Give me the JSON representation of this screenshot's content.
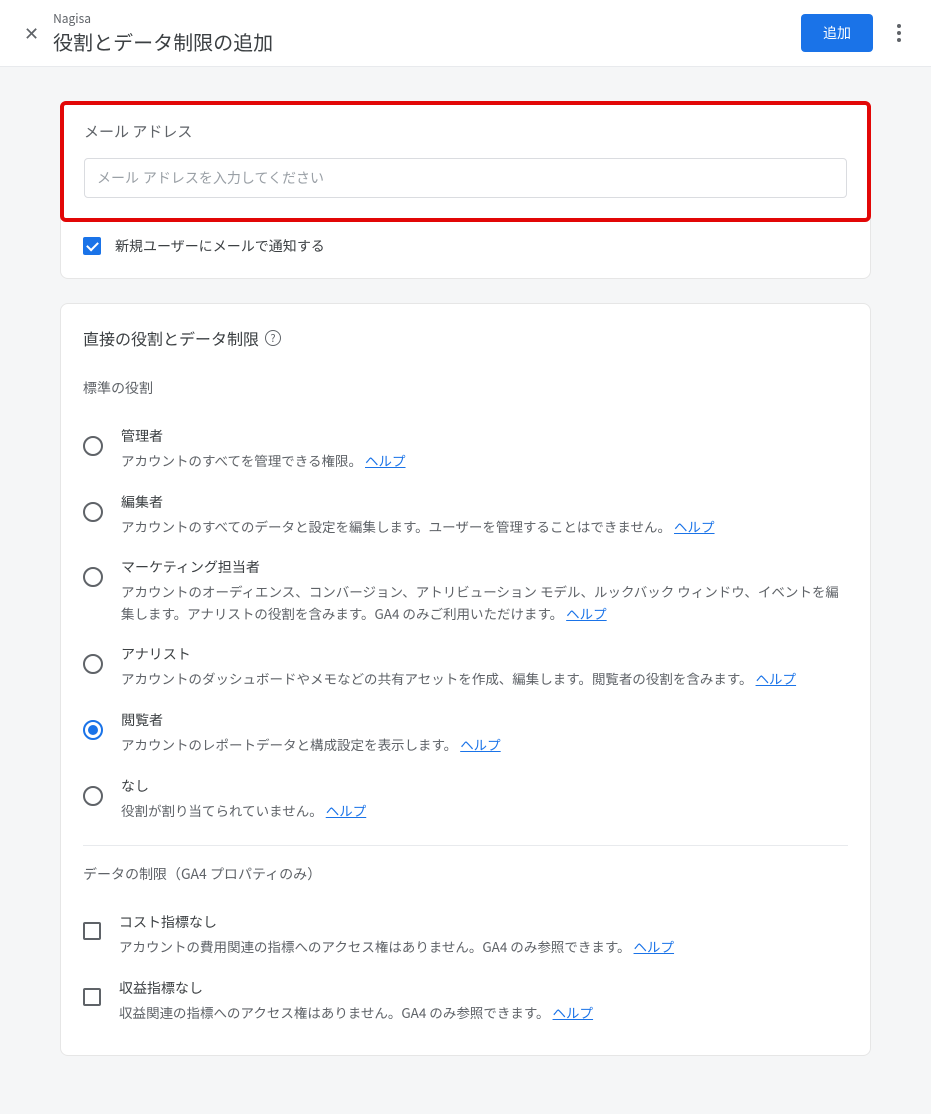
{
  "header": {
    "context": "Nagisa",
    "title": "役割とデータ制限の追加",
    "add_label": "追加"
  },
  "email": {
    "section_label": "メール アドレス",
    "placeholder": "メール アドレスを入力してください",
    "notify_label": "新規ユーザーにメールで通知する"
  },
  "roles": {
    "heading": "直接の役割とデータ制限",
    "standard_label": "標準の役割",
    "help_text": "ヘルプ",
    "items": [
      {
        "title": "管理者",
        "desc": "アカウントのすべてを管理できる権限。",
        "selected": false
      },
      {
        "title": "編集者",
        "desc": "アカウントのすべてのデータと設定を編集します。ユーザーを管理することはできません。",
        "selected": false
      },
      {
        "title": "マーケティング担当者",
        "desc": "アカウントのオーディエンス、コンバージョン、アトリビューション モデル、ルックバック ウィンドウ、イベントを編集します。アナリストの役割を含みます。GA4 のみご利用いただけます。",
        "selected": false
      },
      {
        "title": "アナリスト",
        "desc": "アカウントのダッシュボードやメモなどの共有アセットを作成、編集します。閲覧者の役割を含みます。",
        "selected": false
      },
      {
        "title": "閲覧者",
        "desc": "アカウントのレポートデータと構成設定を表示します。",
        "selected": true
      },
      {
        "title": "なし",
        "desc": "役割が割り当てられていません。",
        "selected": false
      }
    ],
    "restrictions_label": "データの制限（GA4 プロパティのみ）",
    "restrictions": [
      {
        "title": "コスト指標なし",
        "desc": "アカウントの費用関連の指標へのアクセス権はありません。GA4 のみ参照できます。"
      },
      {
        "title": "収益指標なし",
        "desc": "収益関連の指標へのアクセス権はありません。GA4 のみ参照できます。"
      }
    ]
  }
}
